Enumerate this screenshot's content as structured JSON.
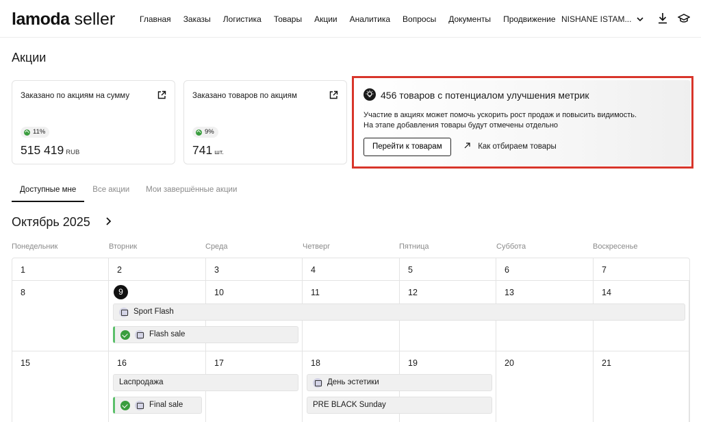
{
  "header": {
    "logo_bold": "lamoda",
    "logo_rest": " seller",
    "nav": [
      "Главная",
      "Заказы",
      "Логистика",
      "Товары",
      "Акции",
      "Аналитика",
      "Вопросы",
      "Документы",
      "Продвижение"
    ],
    "user": "NISHANE ISTAM...",
    "icons": [
      "download-icon",
      "education-cap-icon"
    ]
  },
  "page_title": "Акции",
  "stats": [
    {
      "label": "Заказано по акциям на сумму",
      "badge": "11%",
      "value": "515 419",
      "unit": "RUB"
    },
    {
      "label": "Заказано товаров по акциям",
      "badge": "9%",
      "value": "741",
      "unit": "шт."
    }
  ],
  "promo": {
    "title": "456 товаров с потенциалом улучшения метрик",
    "text_line1": "Участие в акциях может помочь ускорить рост продаж и повысить видимость.",
    "text_line2": "На этапе добавления товары будут отмечены отдельно",
    "button": "Перейти к товарам",
    "link": "Как отбираем товары",
    "highlight_color": "#d8352a"
  },
  "tabs": [
    "Доступные мне",
    "Все акции",
    "Мои завершённые акции"
  ],
  "active_tab": 0,
  "calendar": {
    "month": "Октябрь 2025",
    "weekdays": [
      "Понедельник",
      "Вторник",
      "Среда",
      "Четверг",
      "Пятница",
      "Суббота",
      "Воскресенье"
    ],
    "weeks": [
      [
        "1",
        "2",
        "3",
        "4",
        "5",
        "6",
        "7"
      ],
      [
        "8",
        "9",
        "10",
        "11",
        "12",
        "13",
        "14"
      ],
      [
        "15",
        "16",
        "17",
        "18",
        "19",
        "20",
        "21"
      ]
    ],
    "today": "9",
    "events": {
      "sport_flash": "Sport Flash",
      "flash_sale": "Flash sale",
      "rasprodazha": "Laспродажа",
      "den_estetiki": "День эстетики",
      "final_sale": "Final sale",
      "pre_black": "PRE BLACK Sunday"
    }
  }
}
